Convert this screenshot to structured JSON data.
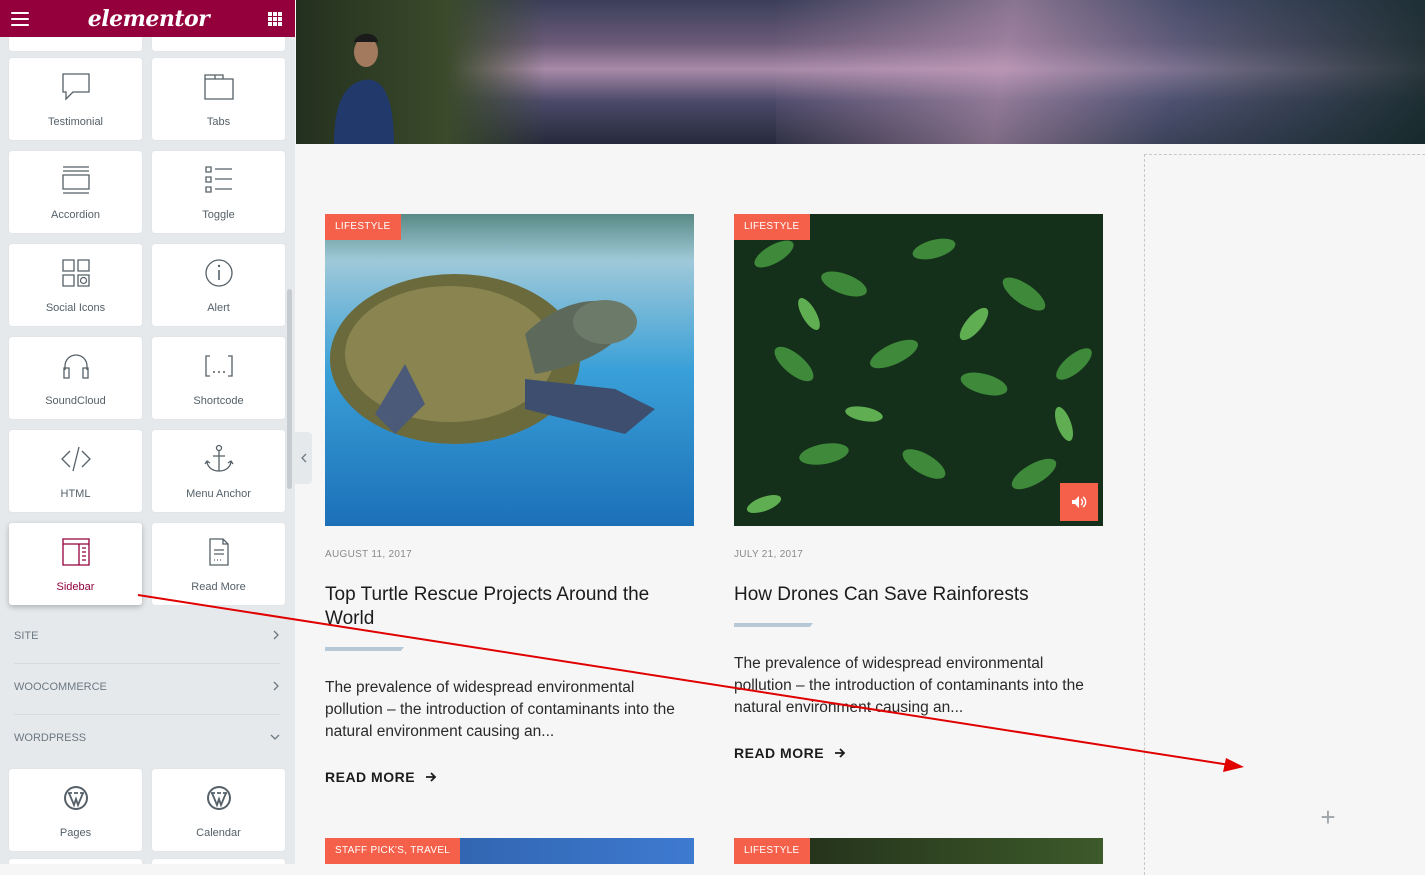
{
  "panel": {
    "logo": "elementor",
    "widgets": [
      {
        "label": "Testimonial",
        "icon": "testimonial-icon"
      },
      {
        "label": "Tabs",
        "icon": "tabs-icon"
      },
      {
        "label": "Accordion",
        "icon": "accordion-icon"
      },
      {
        "label": "Toggle",
        "icon": "toggle-icon"
      },
      {
        "label": "Social Icons",
        "icon": "social-icons-icon"
      },
      {
        "label": "Alert",
        "icon": "alert-icon"
      },
      {
        "label": "SoundCloud",
        "icon": "soundcloud-icon"
      },
      {
        "label": "Shortcode",
        "icon": "shortcode-icon"
      },
      {
        "label": "HTML",
        "icon": "html-icon"
      },
      {
        "label": "Menu Anchor",
        "icon": "anchor-icon"
      },
      {
        "label": "Sidebar",
        "icon": "sidebar-icon"
      },
      {
        "label": "Read More",
        "icon": "read-more-icon"
      }
    ],
    "categories": [
      {
        "label": "SITE",
        "state": "collapsed"
      },
      {
        "label": "WOOCOMMERCE",
        "state": "collapsed"
      },
      {
        "label": "WORDPRESS",
        "state": "expanded"
      }
    ],
    "wp_widgets": [
      {
        "label": "Pages",
        "icon": "wordpress-icon"
      },
      {
        "label": "Calendar",
        "icon": "wordpress-icon"
      }
    ]
  },
  "posts": [
    {
      "category": "LIFESTYLE",
      "date": "AUGUST 11, 2017",
      "title": "Top Turtle Rescue Projects Around the World",
      "excerpt": "The prevalence of widespread environmental pollution – the introduction of contaminants into the natural environment causing an...",
      "read_more": "READ MORE"
    },
    {
      "category": "LIFESTYLE",
      "date": "JULY 21, 2017",
      "title": "How Drones Can Save Rainforests",
      "excerpt": "The prevalence of widespread environmental pollution – the introduction of contaminants into the natural environment causing an...",
      "read_more": "READ MORE"
    },
    {
      "category": "STAFF PICK'S, TRAVEL"
    },
    {
      "category": "LIFESTYLE"
    }
  ],
  "colors": {
    "brand": "#93003c",
    "accent": "#f4604a",
    "drag_arrow": "#e00000"
  },
  "add_symbol": "+"
}
